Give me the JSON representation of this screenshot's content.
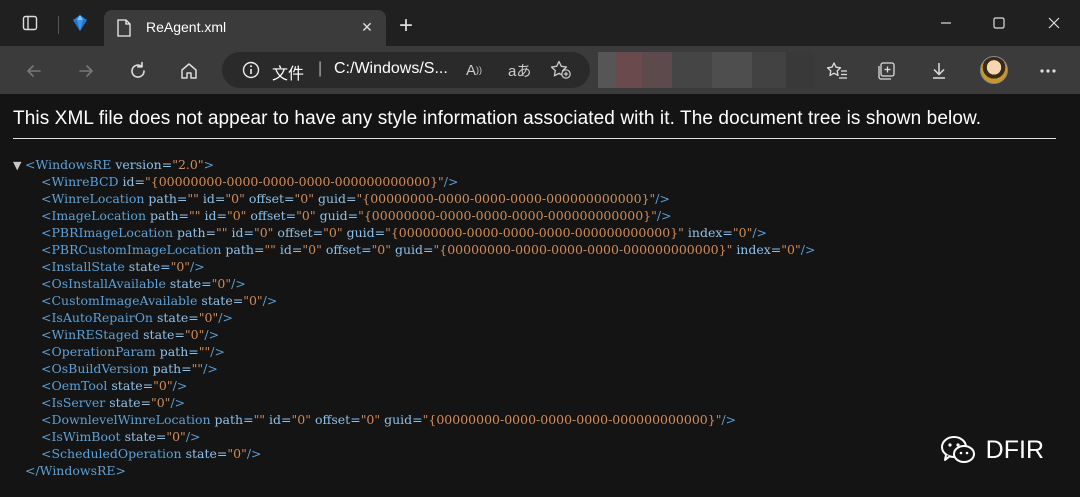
{
  "tab": {
    "title": "ReAgent.xml",
    "close": "✕"
  },
  "new_tab": "+",
  "address": {
    "label": "文件",
    "divider": "|",
    "url": "C:/Windows/S..."
  },
  "notice": "This XML file does not appear to have any style information associated with it. The document tree is shown below.",
  "xml": {
    "open": {
      "toggle": "▼",
      "tag_open": "<WindowsRE",
      "attrs": [
        [
          "version",
          "2.0"
        ]
      ],
      "end": ">"
    },
    "children": [
      {
        "name": "WinreBCD",
        "attrs": [
          [
            "id",
            "{00000000-0000-0000-0000-000000000000}"
          ]
        ]
      },
      {
        "name": "WinreLocation",
        "attrs": [
          [
            "path",
            ""
          ],
          [
            "id",
            "0"
          ],
          [
            "offset",
            "0"
          ],
          [
            "guid",
            "{00000000-0000-0000-0000-000000000000}"
          ]
        ]
      },
      {
        "name": "ImageLocation",
        "attrs": [
          [
            "path",
            ""
          ],
          [
            "id",
            "0"
          ],
          [
            "offset",
            "0"
          ],
          [
            "guid",
            "{00000000-0000-0000-0000-000000000000}"
          ]
        ]
      },
      {
        "name": "PBRImageLocation",
        "attrs": [
          [
            "path",
            ""
          ],
          [
            "id",
            "0"
          ],
          [
            "offset",
            "0"
          ],
          [
            "guid",
            "{00000000-0000-0000-0000-000000000000}"
          ],
          [
            "index",
            "0"
          ]
        ]
      },
      {
        "name": "PBRCustomImageLocation",
        "attrs": [
          [
            "path",
            ""
          ],
          [
            "id",
            "0"
          ],
          [
            "offset",
            "0"
          ],
          [
            "guid",
            "{00000000-0000-0000-0000-000000000000}"
          ],
          [
            "index",
            "0"
          ]
        ]
      },
      {
        "name": "InstallState",
        "attrs": [
          [
            "state",
            "0"
          ]
        ]
      },
      {
        "name": "OsInstallAvailable",
        "attrs": [
          [
            "state",
            "0"
          ]
        ]
      },
      {
        "name": "CustomImageAvailable",
        "attrs": [
          [
            "state",
            "0"
          ]
        ]
      },
      {
        "name": "IsAutoRepairOn",
        "attrs": [
          [
            "state",
            "0"
          ]
        ]
      },
      {
        "name": "WinREStaged",
        "attrs": [
          [
            "state",
            "0"
          ]
        ]
      },
      {
        "name": "OperationParam",
        "attrs": [
          [
            "path",
            ""
          ]
        ]
      },
      {
        "name": "OsBuildVersion",
        "attrs": [
          [
            "path",
            ""
          ]
        ]
      },
      {
        "name": "OemTool",
        "attrs": [
          [
            "state",
            "0"
          ]
        ]
      },
      {
        "name": "IsServer",
        "attrs": [
          [
            "state",
            "0"
          ]
        ]
      },
      {
        "name": "DownlevelWinreLocation",
        "attrs": [
          [
            "path",
            ""
          ],
          [
            "id",
            "0"
          ],
          [
            "offset",
            "0"
          ],
          [
            "guid",
            "{00000000-0000-0000-0000-000000000000}"
          ]
        ]
      },
      {
        "name": "IsWimBoot",
        "attrs": [
          [
            "state",
            "0"
          ]
        ]
      },
      {
        "name": "ScheduledOperation",
        "attrs": [
          [
            "state",
            "0"
          ]
        ]
      }
    ],
    "close": "</WindowsRE>"
  },
  "watermark": {
    "text": "DFIR"
  },
  "colors": {
    "tag": "#5da0d6",
    "attr": "#8fc0e8",
    "value": "#d28c5a",
    "toolbar": "#3b3b3b",
    "tabstrip": "#202020",
    "page": "#141414"
  },
  "icons": [
    "tab-actions-icon",
    "browser-logo-icon",
    "xml-file-icon",
    "close-icon",
    "new-tab-icon",
    "minimize-icon",
    "maximize-icon",
    "window-close-icon",
    "back-icon",
    "forward-icon",
    "refresh-icon",
    "home-icon",
    "info-icon",
    "read-aloud-icon",
    "translate-icon",
    "add-favorite-icon",
    "favorites-icon",
    "collections-icon",
    "downloads-icon",
    "avatar",
    "more-icon",
    "wechat-icon"
  ]
}
